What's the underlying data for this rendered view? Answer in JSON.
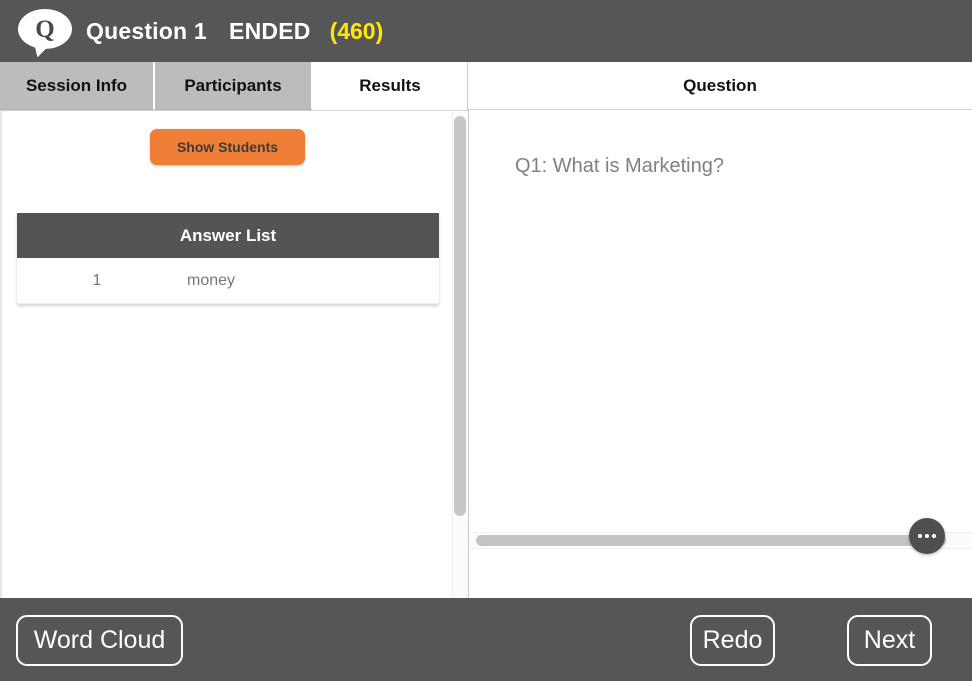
{
  "header": {
    "logo_icon": "speech-bubble-q-icon",
    "logo_letter": "Q",
    "question_label": "Question 1",
    "status": "ENDED",
    "count": "(460)"
  },
  "tabs": [
    {
      "id": "session-info",
      "label": "Session Info",
      "active": false
    },
    {
      "id": "participants",
      "label": "Participants",
      "active": false
    },
    {
      "id": "results",
      "label": "Results",
      "active": true
    }
  ],
  "right_tab": {
    "id": "question",
    "label": "Question"
  },
  "results_panel": {
    "show_students_button": "Show Students",
    "answer_list": {
      "title": "Answer List",
      "rows": [
        {
          "index": "1",
          "answer": "money"
        }
      ]
    },
    "more_options_icon": "ellipsis-icon",
    "scrollbar": "vertical-scrollbar"
  },
  "question_panel": {
    "text": "Q1: What is Marketing?",
    "more_options_icon": "ellipsis-icon",
    "scrollbar": "horizontal-scrollbar"
  },
  "bottom_bar": {
    "word_cloud": "Word Cloud",
    "redo": "Redo",
    "next": "Next"
  },
  "colors": {
    "header_bg": "#565656",
    "accent_orange": "#ef7e36",
    "count_yellow": "#ffe900",
    "tab_inactive": "#bcbcbc",
    "table_header": "#545454"
  }
}
